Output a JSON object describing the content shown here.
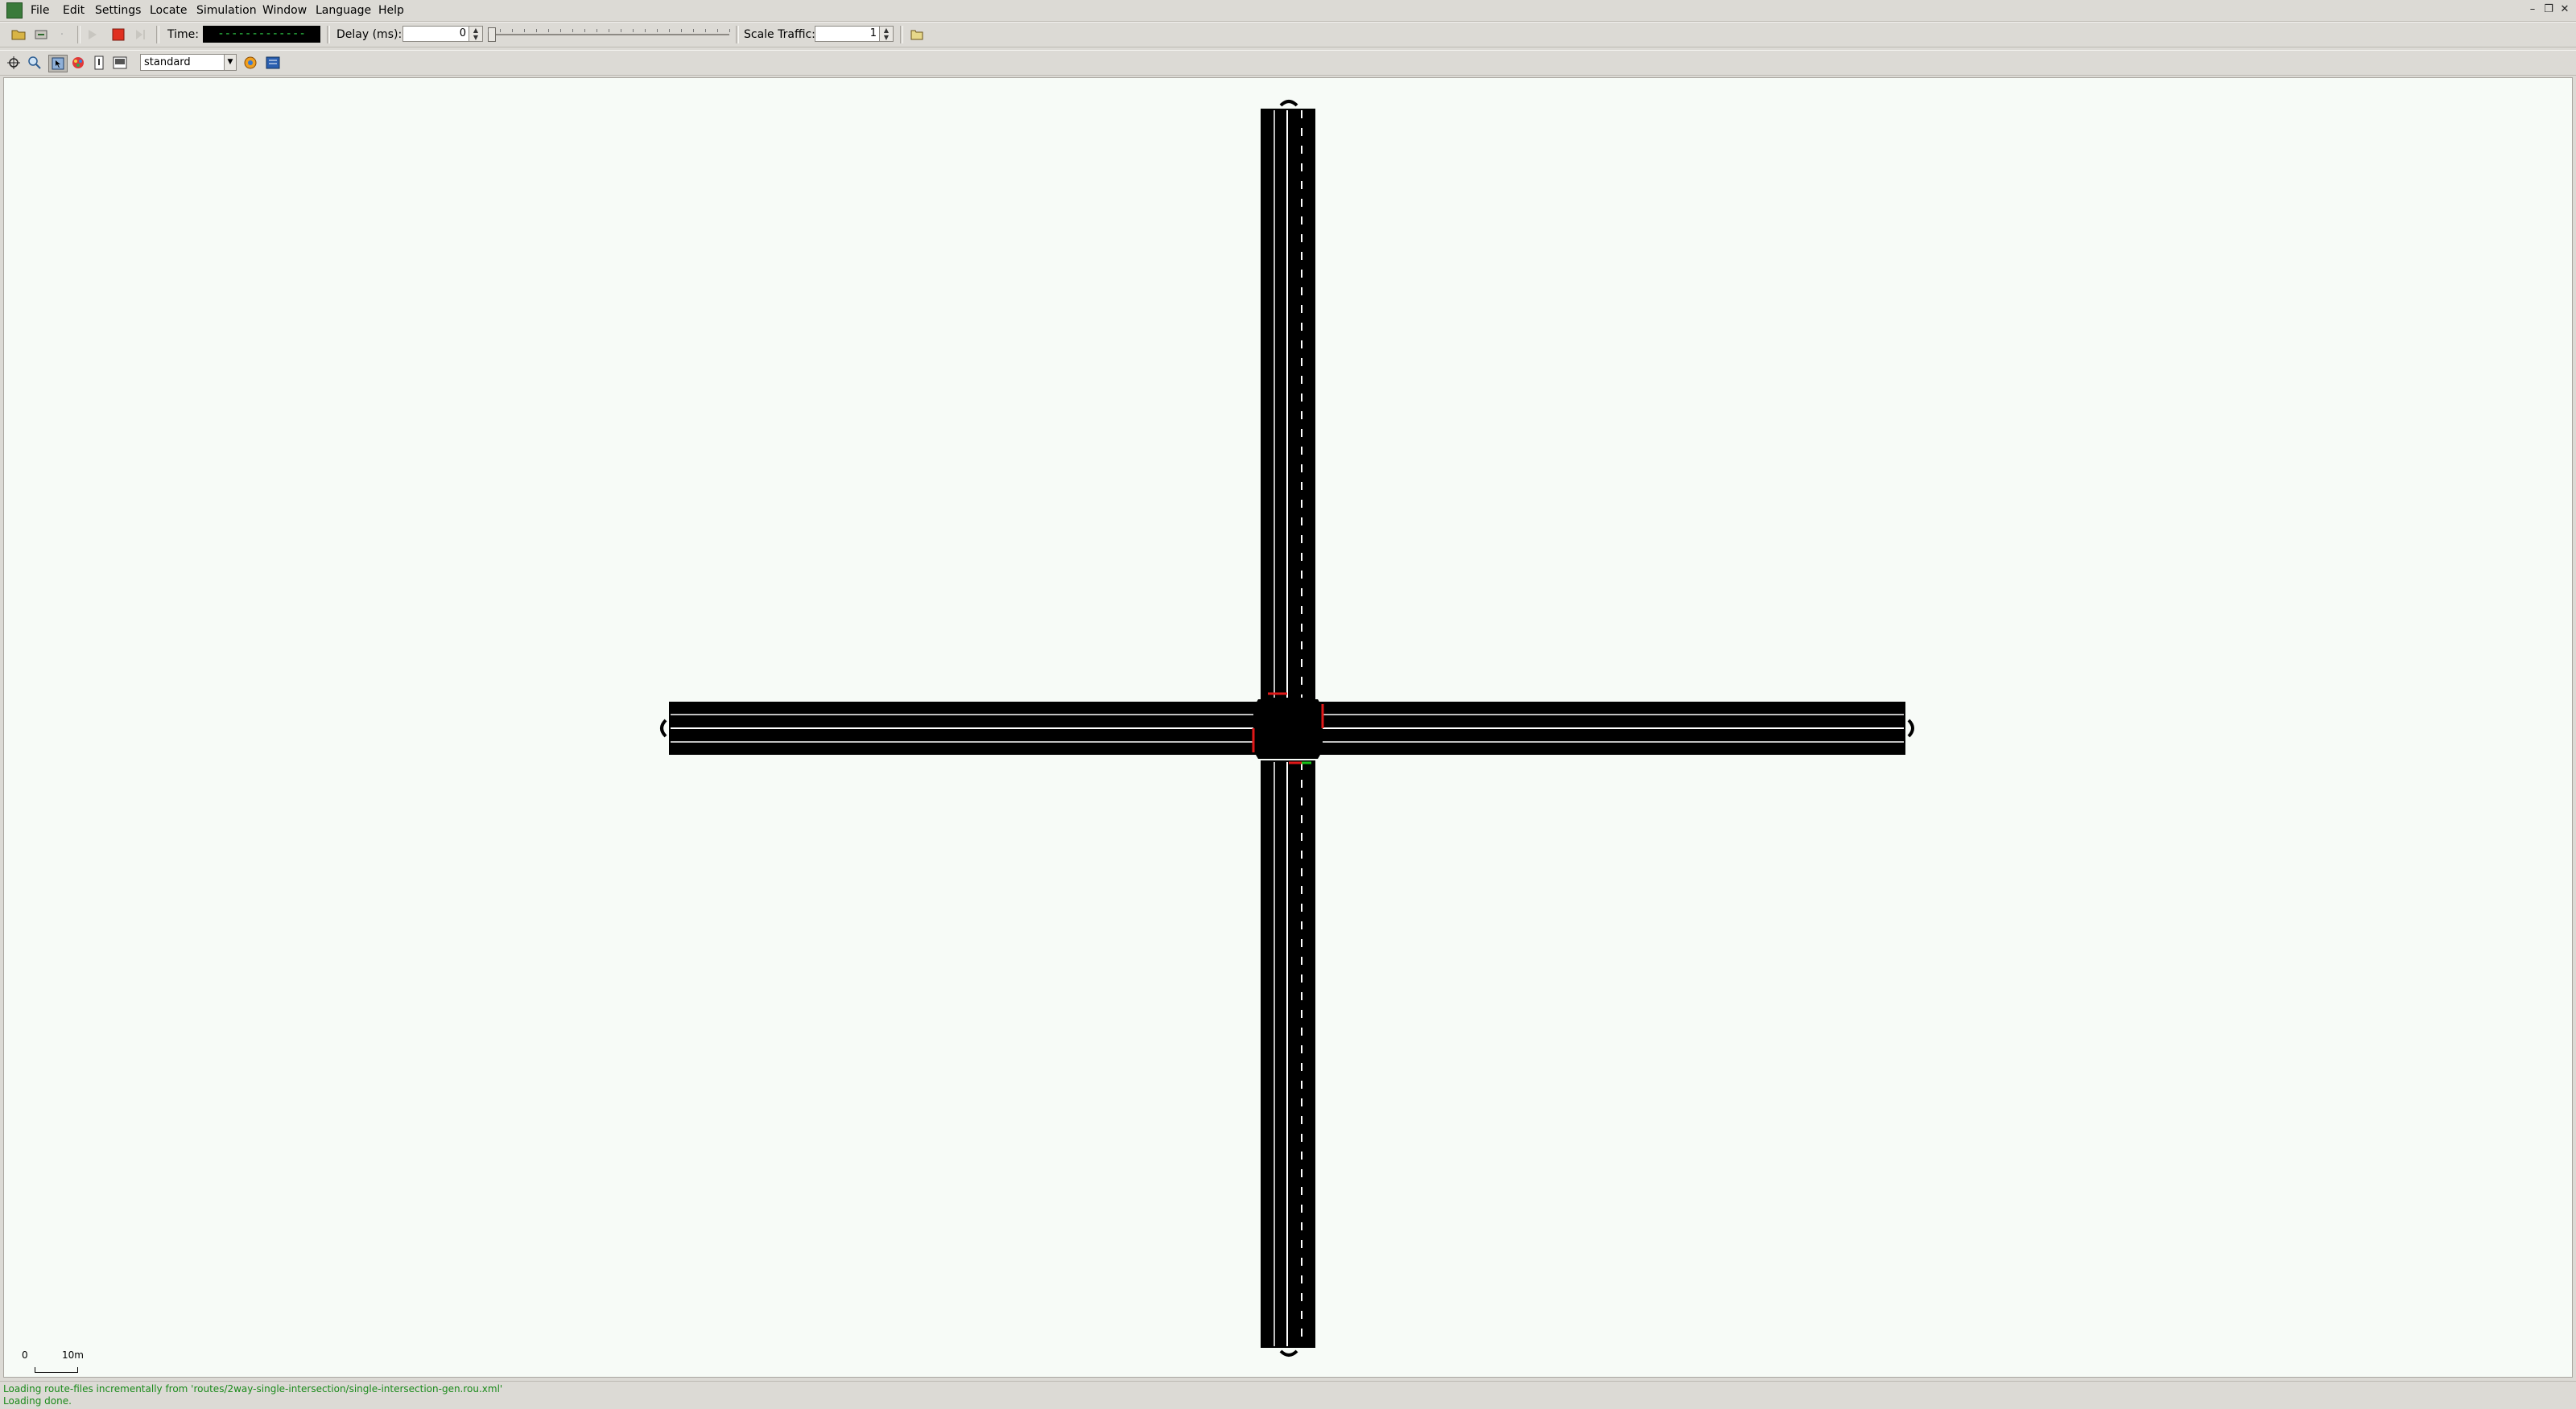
{
  "menu": {
    "items": [
      {
        "label": "File"
      },
      {
        "label": "Edit"
      },
      {
        "label": "Settings"
      },
      {
        "label": "Locate"
      },
      {
        "label": "Simulation"
      },
      {
        "label": "Window"
      },
      {
        "label": "Language"
      },
      {
        "label": "Help"
      }
    ]
  },
  "toolbar": {
    "time_label": "Time:",
    "time_value": "-------------",
    "delay_label": "Delay (ms):",
    "delay_value": "0",
    "delay_level": 0,
    "scale_label": "Scale Traffic:",
    "scale_value": "1",
    "stop_color": "#e03020"
  },
  "view": {
    "scheme": "standard"
  },
  "canvas": {
    "background": "#f7fbf7",
    "road_color": "#000000",
    "lane_marking_color": "#ffffff",
    "signal_red": "#e01818",
    "signal_green": "#18c018",
    "scale": {
      "zero": "0",
      "ten": "10m"
    }
  },
  "messages": {
    "line1": "Loading route-files incrementally from 'routes/2way-single-intersection/single-intersection-gen.rou.xml'",
    "line2": "Loading done."
  }
}
